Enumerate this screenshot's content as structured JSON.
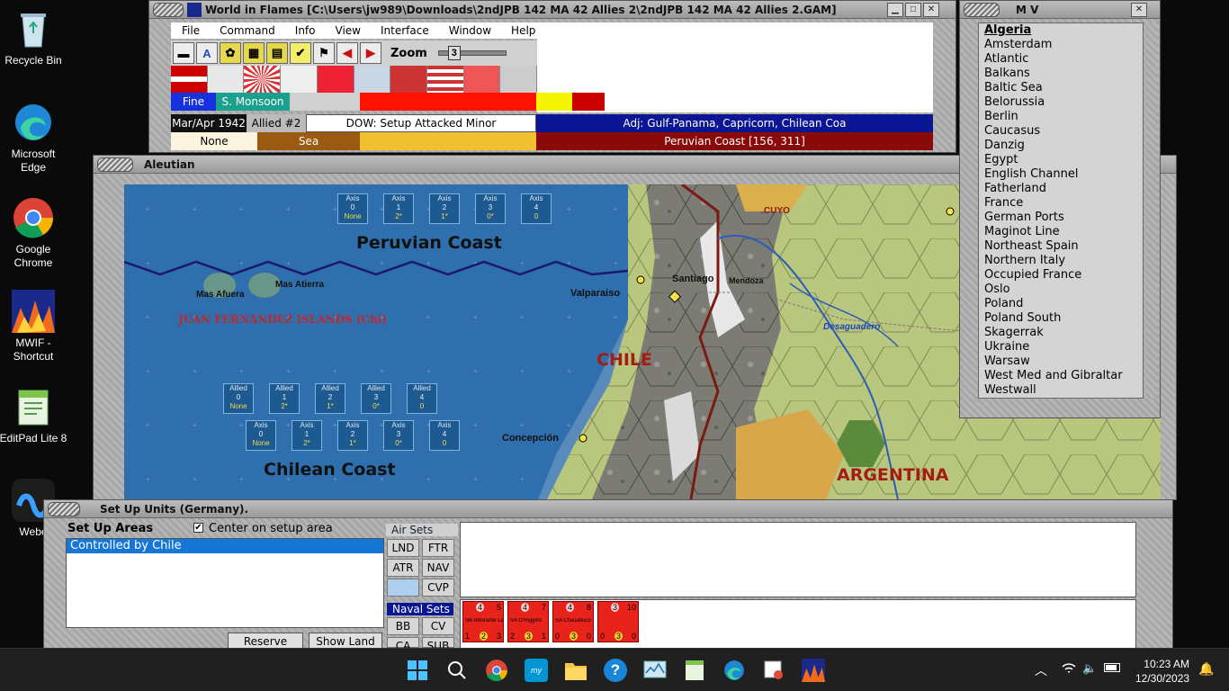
{
  "desktop": {
    "icons": [
      {
        "label": "Recycle Bin"
      },
      {
        "label": "Microsoft Edge"
      },
      {
        "label": "Google Chrome"
      },
      {
        "label": "MWIF - Shortcut"
      },
      {
        "label": "EditPad Lite 8"
      },
      {
        "label": "Webe"
      }
    ]
  },
  "main_window": {
    "title": "World in Flames [C:\\Users\\jw989\\Downloads\\2ndJPB 142 MA 42 Allies 2\\2ndJPB 142 MA 42 Allies 2.GAM]",
    "menu": [
      "File",
      "Command",
      "Info",
      "View",
      "Interface",
      "Window",
      "Help"
    ],
    "zoom_label": "Zoom",
    "zoom_value": "3",
    "weather": "Fine",
    "monsoon": "S. Monsoon",
    "date": "Mar/Apr 1942",
    "impulse": "Allied #2",
    "phase": "DOW: Setup Attacked Minor",
    "adjacent": "Adj: Gulf-Panama, Capricorn, Chilean Coa",
    "none_label": "None",
    "terrain": "Sea",
    "location": "Peruvian Coast [156, 311]"
  },
  "mv_window": {
    "title": "M V",
    "items": [
      "Algeria",
      "Amsterdam",
      "Atlantic",
      "Balkans",
      "Baltic Sea",
      "Belorussia",
      "Berlin",
      "Caucasus",
      "Danzig",
      "Egypt",
      "English Channel",
      "Fatherland",
      "France",
      "German Ports",
      "Maginot Line",
      "Northeast Spain",
      "Northern Italy",
      "Occupied France",
      "Oslo",
      "Poland",
      "Poland South",
      "Skagerrak",
      "Ukraine",
      "Warsaw",
      "West Med and Gibraltar",
      "Westwall"
    ]
  },
  "map_window": {
    "title": "Aleutian",
    "labels": {
      "peruvian_coast": "Peruvian Coast",
      "chilean_coast": "Chilean Coast",
      "juan_fernandez": "JUAN FERNANDEZ ISLANDS (Chi)",
      "mas_afuera": "Mas Afuera",
      "mas_atierra": "Mas Atierra",
      "valparaiso": "Valparaiso",
      "santiago": "Santiago",
      "mendoza": "Mendoza",
      "cuyo": "CUYO",
      "desaguadero": "Desaguadero",
      "chile": "CHILE",
      "argentina": "ARGENTINA",
      "concepcion": "Concepción"
    },
    "unit_boxes_top": [
      {
        "side": "Axis",
        "n": "0",
        "v": "None"
      },
      {
        "side": "Axis",
        "n": "1",
        "v": "2*"
      },
      {
        "side": "Axis",
        "n": "2",
        "v": "1*"
      },
      {
        "side": "Axis",
        "n": "3",
        "v": "0*"
      },
      {
        "side": "Axis",
        "n": "4",
        "v": "0"
      }
    ],
    "unit_boxes_allied": [
      {
        "side": "Allied",
        "n": "0",
        "v": "None"
      },
      {
        "side": "Allied",
        "n": "1",
        "v": "2*"
      },
      {
        "side": "Allied",
        "n": "2",
        "v": "1*"
      },
      {
        "side": "Allied",
        "n": "3",
        "v": "0*"
      },
      {
        "side": "Allied",
        "n": "4",
        "v": "0"
      }
    ],
    "unit_boxes_axis2": [
      {
        "side": "Axis",
        "n": "0",
        "v": "None"
      },
      {
        "side": "Axis",
        "n": "1",
        "v": "2*"
      },
      {
        "side": "Axis",
        "n": "2",
        "v": "1*"
      },
      {
        "side": "Axis",
        "n": "3",
        "v": "0*"
      },
      {
        "side": "Axis",
        "n": "4",
        "v": "0"
      }
    ]
  },
  "setup_window": {
    "title": "Set Up Units (Germany).",
    "areas_label": "Set Up Areas",
    "center_label": "Center on setup area",
    "areas": [
      "Controlled by Chile"
    ],
    "air_sets_label": "Air Sets",
    "air_buttons": [
      "LND",
      "FTR",
      "ATR",
      "NAV",
      "",
      "CVP"
    ],
    "naval_sets_label": "Naval Sets",
    "naval_buttons": [
      "BB",
      "CV",
      "CA",
      "SUB"
    ],
    "reserve_button": "Reserve Units",
    "show_land_button": "Show Land",
    "ships": [
      {
        "top": "4",
        "right": "5",
        "name": "SB Almirante Latorre",
        "b1": "1",
        "b2": "2",
        "b3": "3"
      },
      {
        "top": "4",
        "right": "7",
        "name": "SA O'Higgins",
        "b1": "2",
        "b2": "3",
        "b3": "1"
      },
      {
        "top": "4",
        "right": "8",
        "name": "SA Chacabuco",
        "b1": "0",
        "b2": "3",
        "b3": "0"
      },
      {
        "top": "3",
        "right": "10",
        "name": "",
        "b1": "0",
        "b2": "3",
        "b3": "0"
      }
    ]
  },
  "taskbar": {
    "time": "10:23 AM",
    "date": "12/30/2023"
  }
}
